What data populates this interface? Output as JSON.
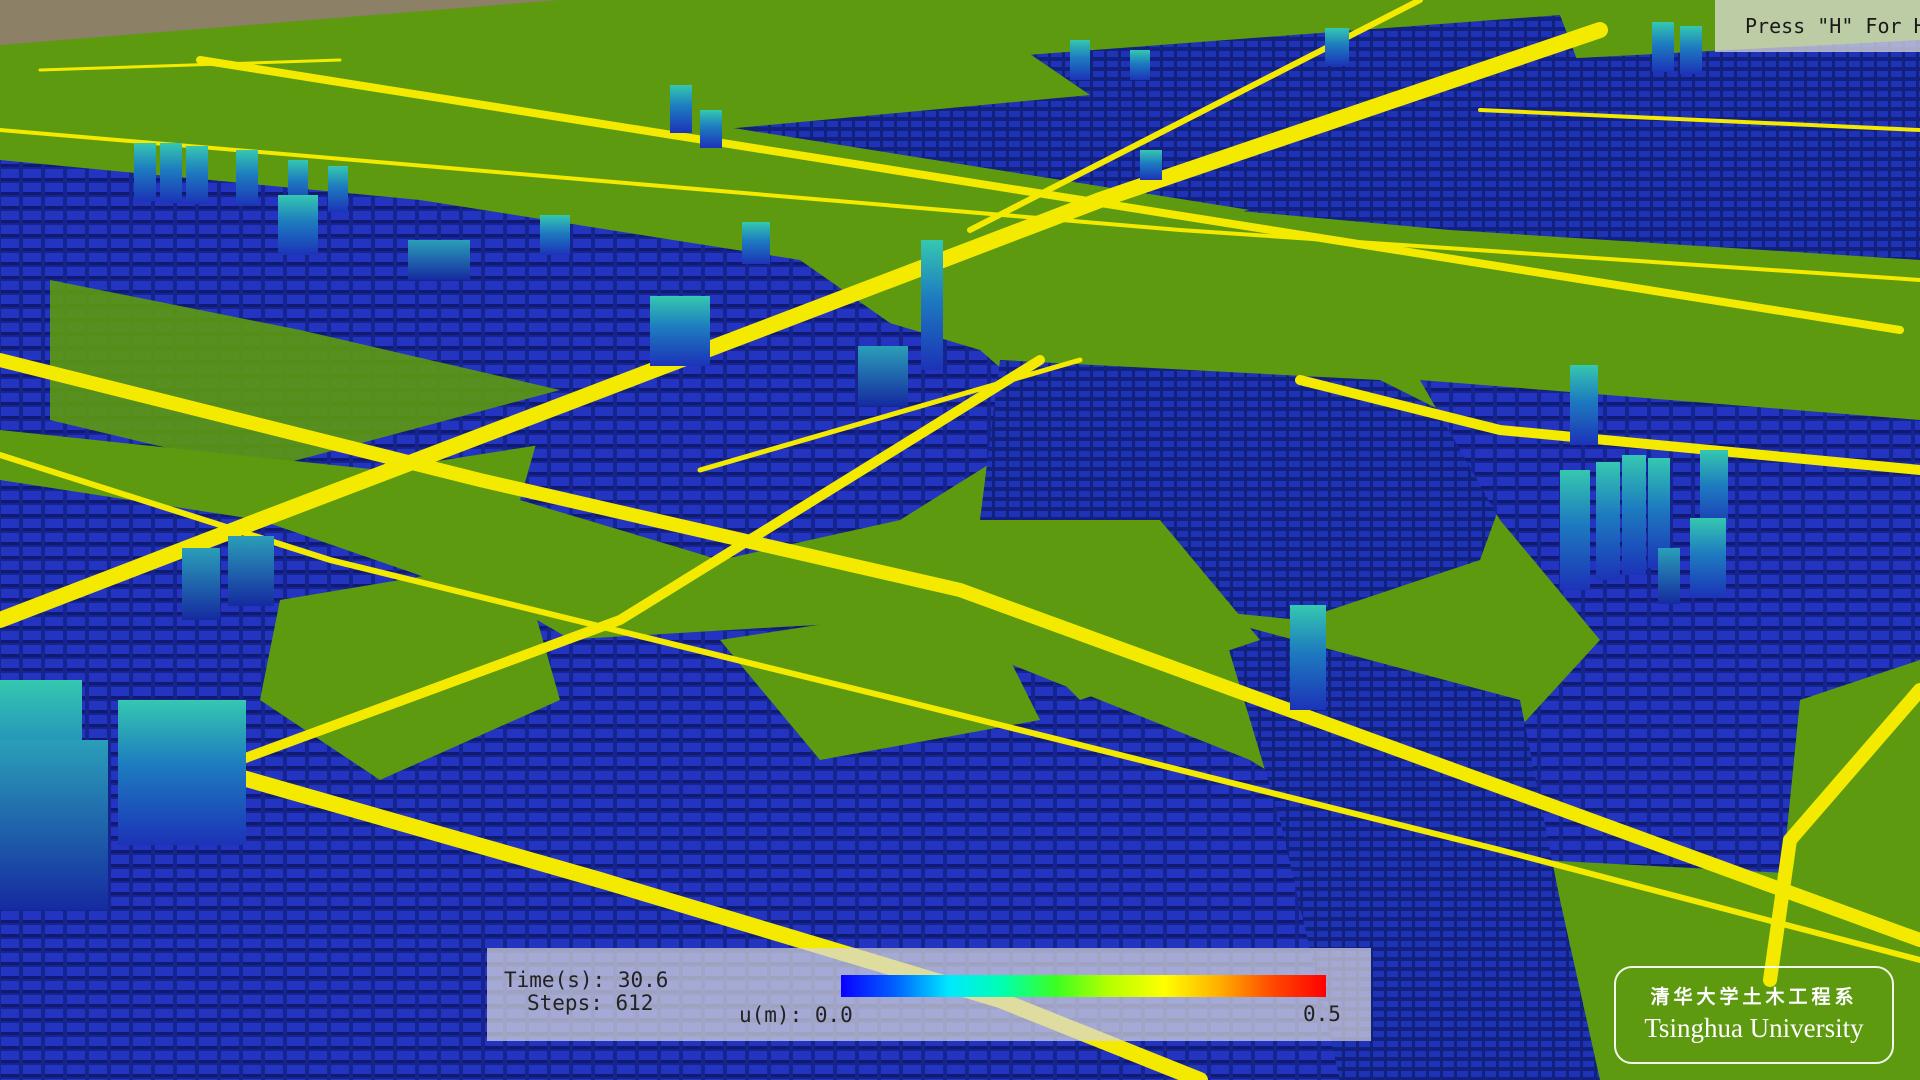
{
  "hint": {
    "text": "Press \"H\" For H"
  },
  "hud": {
    "time_label": "Time(s):",
    "time_value": "30.6",
    "steps_label": "Steps:",
    "steps_value": "612",
    "colorbar_label": "u(m):",
    "colorbar_min": "0.0",
    "colorbar_max": "0.5",
    "colormap": [
      "#0a00ff",
      "#0060ff",
      "#00e8ff",
      "#00ffb0",
      "#3cff20",
      "#b8ff00",
      "#ffff00",
      "#ffb000",
      "#ff4a00",
      "#ff0000"
    ]
  },
  "logo": {
    "chinese": "清华大学土木工程系",
    "english": "Tsinghua University"
  },
  "scene": {
    "ground_color": "#5d9a10",
    "road_color": "#f4ea00",
    "building_low_color": "#1a2aa8",
    "building_high_color": "#2fb7b0",
    "sky_strip_color": "#8c8066"
  }
}
